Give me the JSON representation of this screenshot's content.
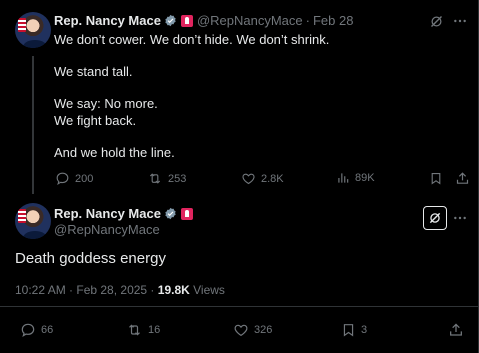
{
  "tweet1": {
    "name": "Rep. Nancy Mace",
    "handle": "@RepNancyMace",
    "dot": "·",
    "date": "Feb 28",
    "lines": [
      "We don’t cower. We don’t hide. We don’t shrink.",
      "",
      "We stand tall.",
      "",
      "We say: No more.",
      "We fight back.",
      "",
      "And we hold the line."
    ],
    "replies": "200",
    "reposts": "253",
    "likes": "2.8K",
    "views": "89K"
  },
  "tweet2": {
    "name": "Rep. Nancy Mace",
    "handle": "@RepNancyMace",
    "text": "Death goddess energy",
    "timestamp": "10:22 AM · Feb 28, 2025 · ",
    "views_count": "19.8K",
    "views_label": " Views",
    "replies": "66",
    "reposts": "16",
    "likes": "326",
    "bookmarks": "3"
  },
  "colors": {
    "background": "#000000",
    "text": "#e7e9ea",
    "muted": "#71767b",
    "verified": "#829aab",
    "gov_badge": "#e0245e"
  },
  "icons": [
    "verified-badge-icon",
    "gov-badge-icon",
    "grok-icon",
    "more-icon",
    "reply-icon",
    "repost-icon",
    "like-icon",
    "views-icon",
    "bookmark-icon",
    "share-icon"
  ]
}
